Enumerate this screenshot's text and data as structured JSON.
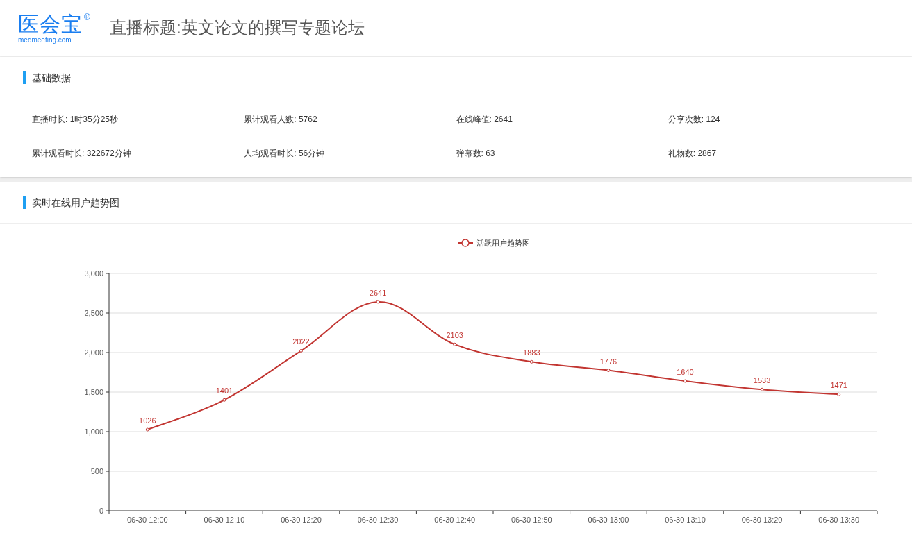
{
  "logo": {
    "name": "医会宝",
    "mark": "®",
    "domain": "medmeeting.com"
  },
  "title": "直播标题:英文论文的撰写专题论坛",
  "basic": {
    "heading": "基础数据",
    "stats": [
      {
        "text": "直播时长: 1时35分25秒"
      },
      {
        "text": "累计观看人数: 5762"
      },
      {
        "text": "在线峰值: 2641"
      },
      {
        "text": "分享次数: 124"
      },
      {
        "text": "累计观看时长: 322672分钟"
      },
      {
        "text": "人均观看时长: 56分钟"
      },
      {
        "text": "弹幕数: 63"
      },
      {
        "text": "礼物数: 2867"
      }
    ]
  },
  "trend": {
    "heading": "实时在线用户趋势图",
    "chart_data": {
      "type": "line",
      "categories": [
        "06-30 12:00",
        "06-30 12:10",
        "06-30 12:20",
        "06-30 12:30",
        "06-30 12:40",
        "06-30 12:50",
        "06-30 13:00",
        "06-30 13:10",
        "06-30 13:20",
        "06-30 13:30"
      ],
      "grid": true,
      "series": [
        {
          "name": "活跃用户趋势图",
          "color": "#c23531",
          "marker": "circle",
          "values": [
            1026,
            1401,
            2022,
            2641,
            2103,
            1883,
            1776,
            1640,
            1533,
            1471
          ]
        }
      ],
      "ylim": [
        0,
        3000
      ],
      "yticks": [
        {
          "value": 0,
          "label": "0"
        },
        {
          "value": 500,
          "label": "500"
        },
        {
          "value": 1000,
          "label": "1,000"
        },
        {
          "value": 1500,
          "label": "1,500"
        },
        {
          "value": 2000,
          "label": "2,000"
        },
        {
          "value": 2500,
          "label": "2,500"
        },
        {
          "value": 3000,
          "label": "3,000"
        }
      ],
      "data_labels": true
    }
  }
}
